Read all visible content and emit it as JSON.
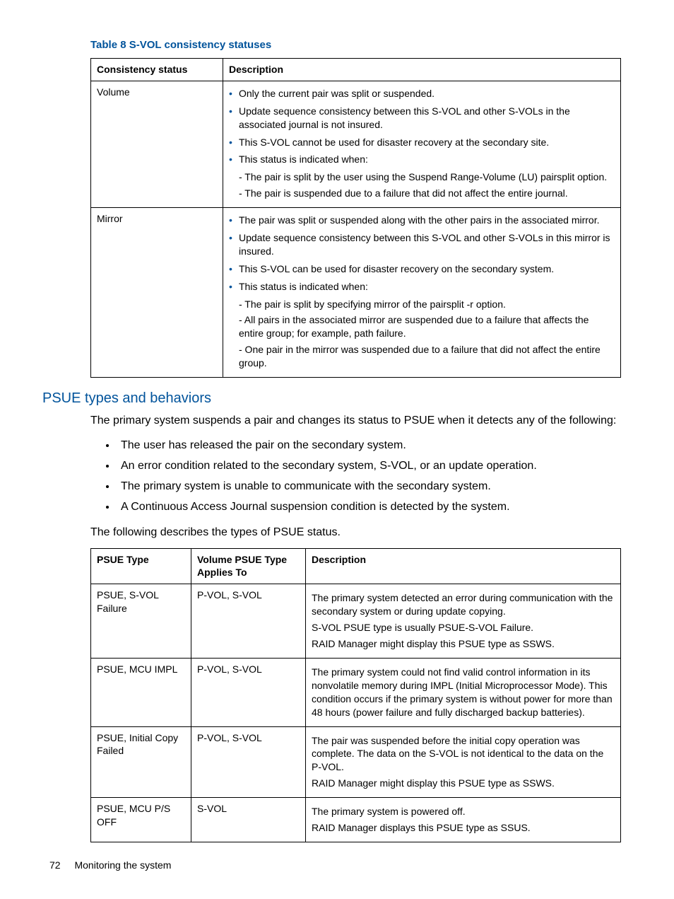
{
  "table8": {
    "caption": "Table 8 S-VOL consistency statuses",
    "headers": [
      "Consistency status",
      "Description"
    ],
    "rows": [
      {
        "status": "Volume",
        "bullets": [
          "Only the current pair was split or suspended.",
          "Update sequence consistency between this S-VOL and other S-VOLs in the associated journal is not insured.",
          "This S-VOL cannot be used for disaster recovery at the secondary site.",
          "This status is indicated when:"
        ],
        "sublines": [
          "- The pair is split by the user using the Suspend Range-Volume (LU) pairsplit option.",
          "- The pair is suspended due to a failure that did not affect the entire journal."
        ]
      },
      {
        "status": "Mirror",
        "bullets": [
          "The pair was split or suspended along with the other pairs in the associated mirror.",
          "Update sequence consistency between this S-VOL and other S-VOLs in this mirror is insured.",
          "This S-VOL can be used for disaster recovery on the secondary system.",
          "This status is indicated when:"
        ],
        "sublines": [
          "- The pair is split by specifying mirror of the pairsplit -r option.",
          "- All pairs in the associated mirror are suspended due to a failure that affects the entire group; for example, path failure.",
          "- One pair in the mirror was suspended due to a failure that did not affect the entire group."
        ]
      }
    ]
  },
  "section": {
    "heading": "PSUE types and behaviors",
    "intro": "The primary system suspends a pair and changes its status to PSUE when it detects any of the following:",
    "list": [
      "The user has released the pair on the secondary system.",
      "An error condition related to the secondary system, S-VOL, or an update operation.",
      "The primary system is unable to communicate with the secondary system.",
      "A Continuous Access Journal suspension condition is detected by the system."
    ],
    "outro": "The following describes the types of PSUE status."
  },
  "table9": {
    "headers": [
      "PSUE Type",
      "Volume PSUE Type Applies To",
      "Description"
    ],
    "rows": [
      {
        "type": "PSUE, S-VOL Failure",
        "applies": "P-VOL, S-VOL",
        "desc": [
          "The primary system detected an error during communication with the secondary system or during update copying.",
          "S-VOL PSUE type is usually PSUE-S-VOL Failure.",
          "RAID Manager might display this PSUE type as SSWS."
        ]
      },
      {
        "type": "PSUE, MCU IMPL",
        "applies": "P-VOL, S-VOL",
        "desc": [
          "The primary system could not find valid control information in its nonvolatile memory during IMPL (Initial Microprocessor Mode). This condition occurs if the primary system is without power for more than 48 hours (power failure and fully discharged backup batteries)."
        ]
      },
      {
        "type": "PSUE, Initial Copy Failed",
        "applies": "P-VOL, S-VOL",
        "desc": [
          "The pair was suspended before the initial copy operation was complete. The data on the S-VOL is not identical to the data on the P-VOL.",
          "RAID Manager might display this PSUE type as SSWS."
        ]
      },
      {
        "type": "PSUE, MCU P/S OFF",
        "applies": "S-VOL",
        "desc": [
          "The primary system is powered off.",
          "RAID Manager displays this PSUE type as SSUS."
        ]
      }
    ]
  },
  "footer": {
    "page": "72",
    "title": "Monitoring the system"
  }
}
